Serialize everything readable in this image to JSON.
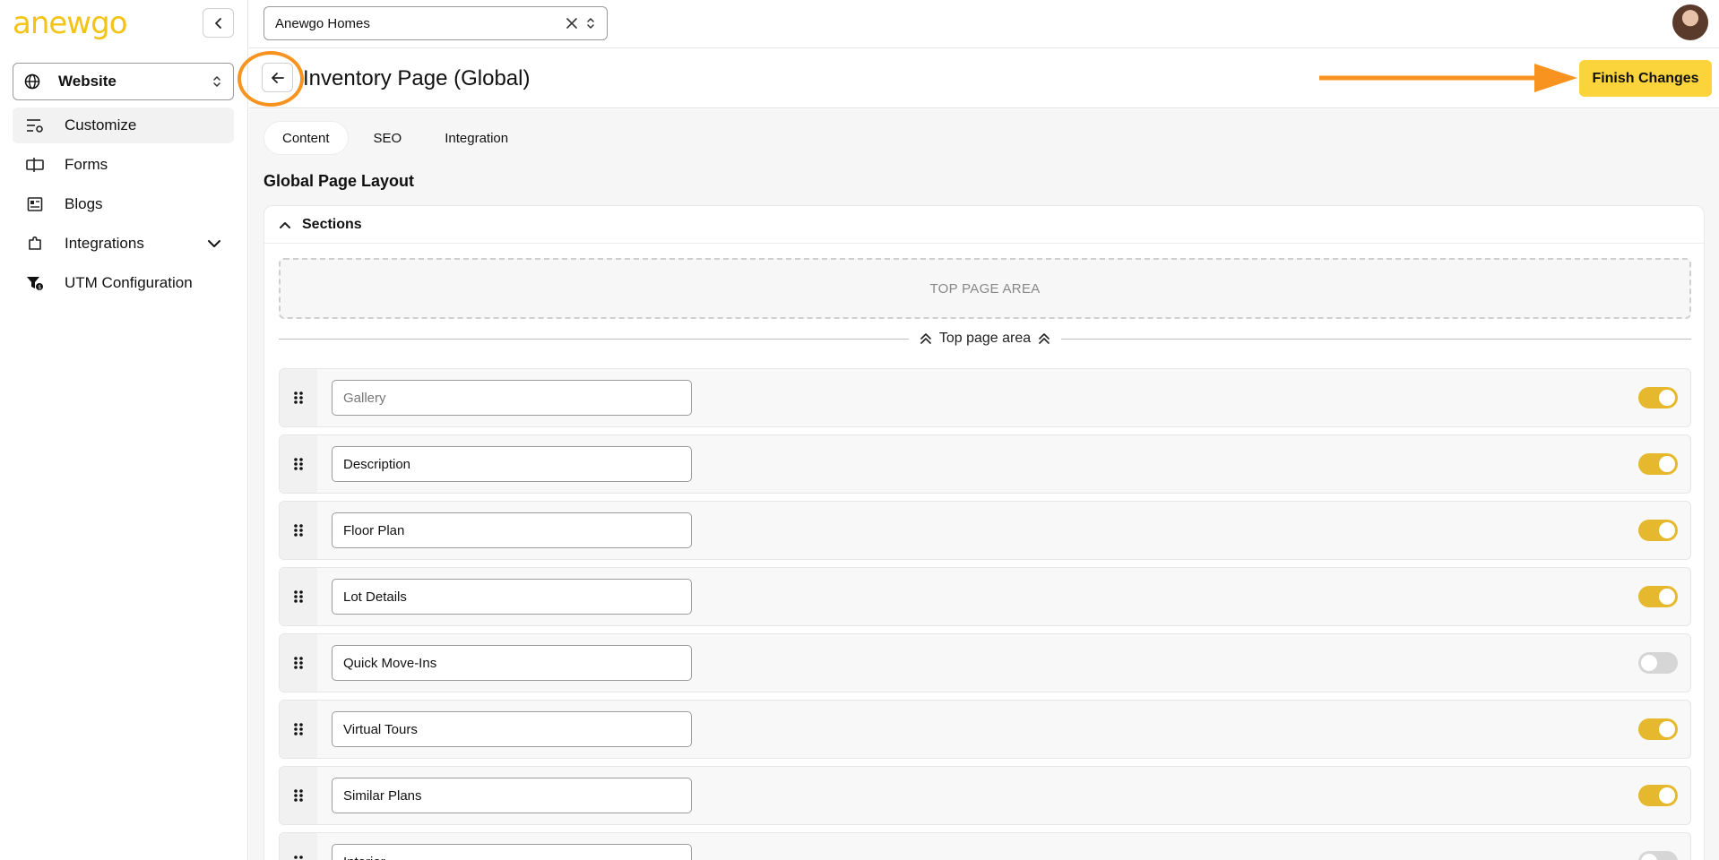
{
  "app": {
    "logo_text": "anewgo",
    "accent_color": "#fbd33b",
    "annotation_color": "#f7931e"
  },
  "sidebar": {
    "site_select": {
      "value": "Website",
      "icon": "globe-icon"
    },
    "items": [
      {
        "label": "Customize",
        "icon": "sliders-icon",
        "active": true
      },
      {
        "label": "Forms",
        "icon": "form-icon"
      },
      {
        "label": "Blogs",
        "icon": "newspaper-icon"
      },
      {
        "label": "Integrations",
        "icon": "puzzle-icon",
        "expandable": true
      },
      {
        "label": "UTM Configuration",
        "icon": "funnel-icon"
      }
    ]
  },
  "topbar": {
    "org_select": {
      "value": "Anewgo Homes"
    }
  },
  "header": {
    "title": "Inventory Page (Global)",
    "finish_label": "Finish Changes"
  },
  "tabs": [
    {
      "label": "Content",
      "active": true
    },
    {
      "label": "SEO"
    },
    {
      "label": "Integration"
    }
  ],
  "main": {
    "section_title": "Global Page Layout",
    "card_title": "Sections",
    "drop_zone_label": "TOP PAGE AREA",
    "divider_label": "Top page area",
    "rows": [
      {
        "value": "",
        "placeholder": "Gallery",
        "enabled": true
      },
      {
        "value": "Description",
        "placeholder": "",
        "enabled": true
      },
      {
        "value": "Floor Plan",
        "placeholder": "",
        "enabled": true
      },
      {
        "value": "Lot Details",
        "placeholder": "",
        "enabled": true
      },
      {
        "value": "Quick Move-Ins",
        "placeholder": "",
        "enabled": false
      },
      {
        "value": "Virtual Tours",
        "placeholder": "",
        "enabled": true
      },
      {
        "value": "Similar Plans",
        "placeholder": "",
        "enabled": true
      },
      {
        "value": "Interior",
        "placeholder": "",
        "enabled": false
      }
    ]
  }
}
